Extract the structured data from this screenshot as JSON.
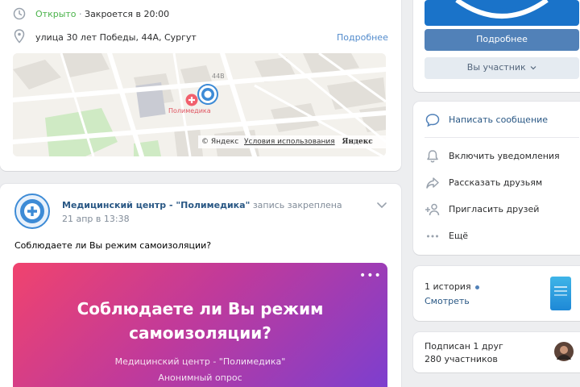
{
  "info": {
    "status_open": "Открыто",
    "status_sep": " · ",
    "status_close": "Закроется в 20:00",
    "address": "улица 30 лет Победы, 44А, Сургут",
    "more_link": "Подробнее"
  },
  "map": {
    "house_number": "44В",
    "place_label": "Полимедика",
    "attribution": "© Яндекс",
    "terms": "Условия использования",
    "logo": "Яндекс"
  },
  "post": {
    "author": "Медицинский центр - \"Полимедика\"",
    "pinned_note": "запись закреплена",
    "date": "21 апр в 13:38",
    "text": "Соблюдаете ли Вы режим самоизоляции?",
    "poll": {
      "question_line1": "Соблюдаете ли Вы режим",
      "question_line2": "самоизоляции?",
      "author": "Медицинский центр - \"Полимедика\"",
      "type": "Анонимный опрос",
      "menu": "•••",
      "gradient_start": "#f0436e",
      "gradient_end": "#7b3fd0"
    }
  },
  "sidebar": {
    "more_button": "Подробнее",
    "member_button": "Вы участник",
    "actions": [
      {
        "label": "Написать сообщение",
        "icon": "message-icon",
        "accent": true
      },
      {
        "label": "Включить уведомления",
        "icon": "bell-icon",
        "accent": false
      },
      {
        "label": "Рассказать друзьям",
        "icon": "share-icon",
        "accent": false
      },
      {
        "label": "Пригласить друзей",
        "icon": "add-user-icon",
        "accent": false
      },
      {
        "label": "Ещё",
        "icon": "more-icon",
        "accent": false
      }
    ],
    "stories_count": "1 история",
    "stories_link": "Смотреть",
    "friend_subscribed": "Подписан 1 друг",
    "members_count": "280 участников"
  },
  "colors": {
    "accent": "#5181b8",
    "link": "#2a5885",
    "open_status": "#4bb34b",
    "background": "#edeef0"
  }
}
